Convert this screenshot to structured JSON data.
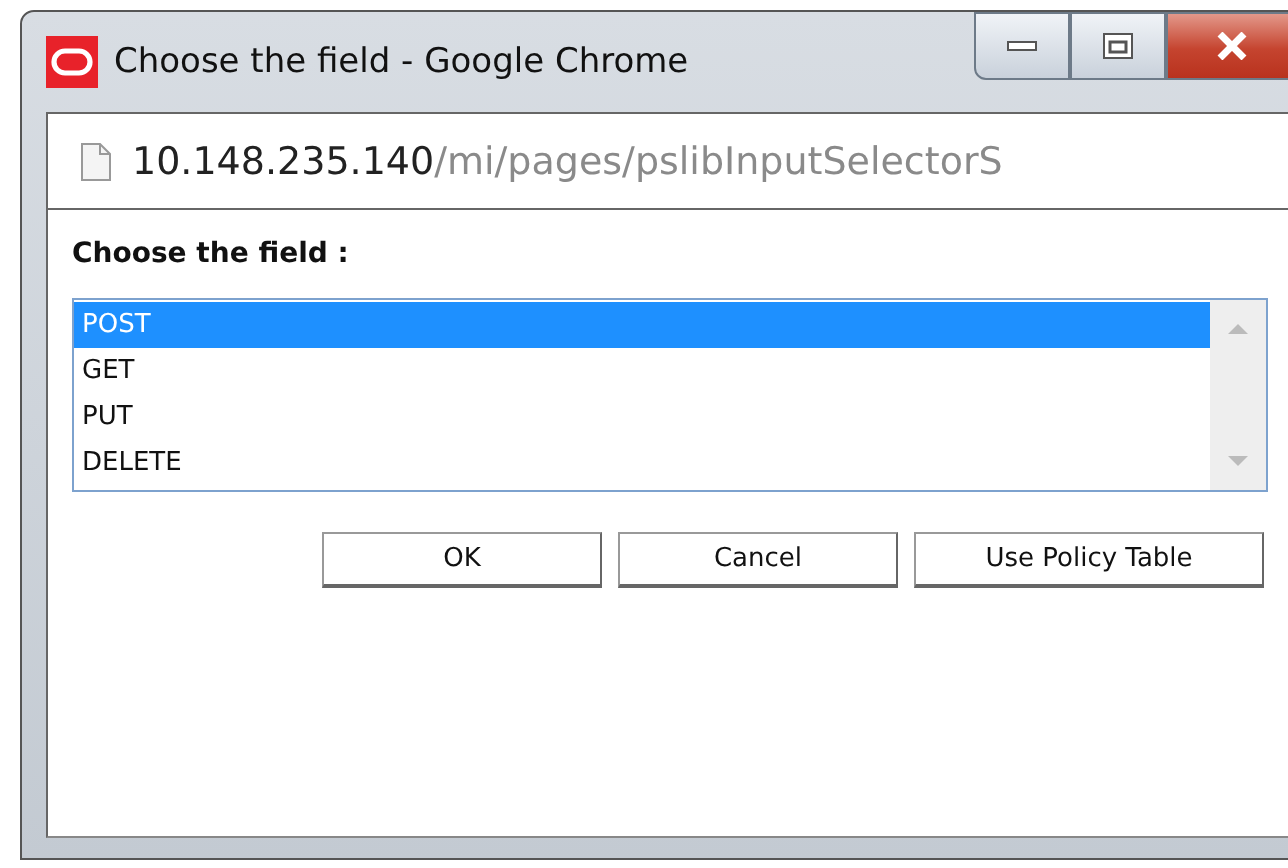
{
  "window": {
    "title": "Choose the field - Google Chrome"
  },
  "address_bar": {
    "host": "10.148.235.140",
    "path": "/mi/pages/pslibInputSelectorS"
  },
  "prompt": "Choose the field :",
  "options": [
    {
      "label": "POST",
      "selected": true
    },
    {
      "label": "GET",
      "selected": false
    },
    {
      "label": "PUT",
      "selected": false
    },
    {
      "label": "DELETE",
      "selected": false
    }
  ],
  "buttons": [
    "OK",
    "Cancel",
    "Use Policy Table"
  ]
}
